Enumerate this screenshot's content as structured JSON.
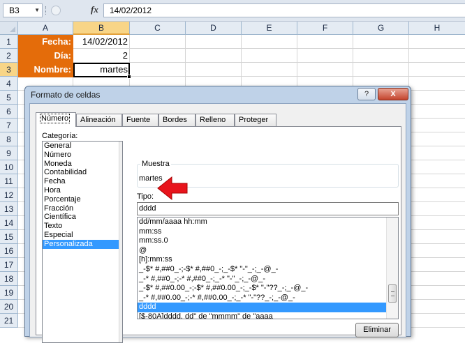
{
  "formula_bar": {
    "name_box": "B3",
    "name_box_dropdown_icon": "chevron-down-icon",
    "fx_label": "fx",
    "formula": "14/02/2012"
  },
  "sheet": {
    "columns": [
      "A",
      "B",
      "C",
      "D",
      "E",
      "F",
      "G",
      "H"
    ],
    "selected_column": "B",
    "rows": [
      "1",
      "2",
      "3",
      "4",
      "5",
      "6",
      "7",
      "8",
      "9",
      "10",
      "11",
      "12",
      "13",
      "14",
      "15",
      "16",
      "17",
      "18",
      "19",
      "20",
      "21"
    ],
    "selected_row": "3",
    "cells": {
      "A1": "Fecha:",
      "B1": "14/02/2012",
      "A2": "Día:",
      "B2": "2",
      "A3": "Nombre:",
      "B3": "martes"
    },
    "label_color": "#e46c0a"
  },
  "dialog": {
    "title": "Formato de celdas",
    "help_label": "?",
    "close_label": "X",
    "tabs": [
      {
        "label": "Número",
        "active": true
      },
      {
        "label": "Alineación",
        "active": false
      },
      {
        "label": "Fuente",
        "active": false
      },
      {
        "label": "Bordes",
        "active": false
      },
      {
        "label": "Relleno",
        "active": false
      },
      {
        "label": "Proteger",
        "active": false
      }
    ],
    "categoria_label": "Categoría:",
    "categories": [
      {
        "label": "General",
        "selected": false
      },
      {
        "label": "Número",
        "selected": false
      },
      {
        "label": "Moneda",
        "selected": false
      },
      {
        "label": "Contabilidad",
        "selected": false
      },
      {
        "label": "Fecha",
        "selected": false
      },
      {
        "label": "Hora",
        "selected": false
      },
      {
        "label": "Porcentaje",
        "selected": false
      },
      {
        "label": "Fracción",
        "selected": false
      },
      {
        "label": "Científica",
        "selected": false
      },
      {
        "label": "Texto",
        "selected": false
      },
      {
        "label": "Especial",
        "selected": false
      },
      {
        "label": "Personalizada",
        "selected": true
      }
    ],
    "muestra_label": "Muestra",
    "muestra_value": "martes",
    "tipo_label": "Tipo:",
    "tipo_value": "dddd",
    "formats": [
      {
        "label": "dd/mm/aaaa hh:mm",
        "selected": false
      },
      {
        "label": "mm:ss",
        "selected": false
      },
      {
        "label": "mm:ss.0",
        "selected": false
      },
      {
        "label": "@",
        "selected": false
      },
      {
        "label": "[h]:mm:ss",
        "selected": false
      },
      {
        "label": "_-$* #,##0_-;-$* #,##0_-;_-$* \"-\"_-;_-@_-",
        "selected": false
      },
      {
        "label": "_-* #,##0_-;-* #,##0_-;_-* \"-\"_-;_-@_-",
        "selected": false
      },
      {
        "label": "_-$* #,##0.00_-;-$* #,##0.00_-;_-$* \"-\"??_-;_-@_-",
        "selected": false
      },
      {
        "label": "_-* #,##0.00_-;-* #,##0.00_-;_-* \"-\"??_-;_-@_-",
        "selected": false
      },
      {
        "label": "dddd",
        "selected": true
      },
      {
        "label": "[$-80A]dddd, dd\" de \"mmmm\" de \"aaaa",
        "selected": false
      }
    ],
    "eliminar_label": "Eliminar",
    "selection_color": "#3399ff",
    "annotation_arrow_color": "#e8141c"
  }
}
